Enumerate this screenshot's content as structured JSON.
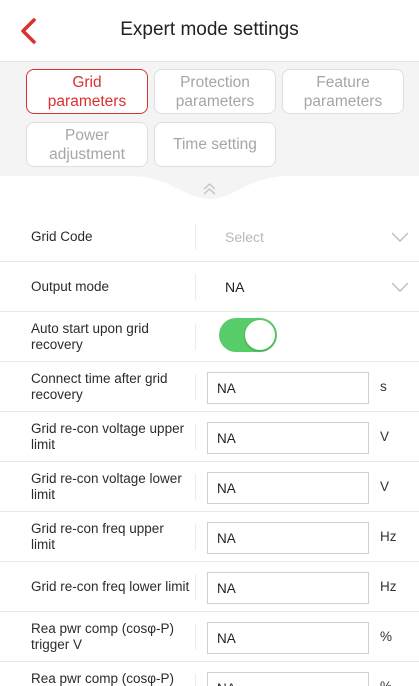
{
  "header": {
    "title": "Expert mode settings"
  },
  "tabs": [
    {
      "id": "grid",
      "label": "Grid\nparameters",
      "active": true
    },
    {
      "id": "protection",
      "label": "Protection\nparameters",
      "active": false
    },
    {
      "id": "feature",
      "label": "Feature\nparameters",
      "active": false
    },
    {
      "id": "power",
      "label": "Power\nadjustment",
      "active": false
    },
    {
      "id": "time",
      "label": "Time setting",
      "active": false
    }
  ],
  "rows": [
    {
      "label": "Grid Code",
      "type": "select",
      "value": "Select",
      "placeholder": true
    },
    {
      "label": "Output mode",
      "type": "select",
      "value": "NA",
      "placeholder": false
    },
    {
      "label": "Auto start upon grid recovery",
      "type": "toggle",
      "on": true
    },
    {
      "label": "Connect time after grid recovery",
      "type": "input",
      "value": "NA",
      "unit": "s"
    },
    {
      "label": "Grid re-con voltage upper limit",
      "type": "input",
      "value": "NA",
      "unit": "V"
    },
    {
      "label": "Grid re-con voltage lower limit",
      "type": "input",
      "value": "NA",
      "unit": "V"
    },
    {
      "label": "Grid re-con freq upper limit",
      "type": "input",
      "value": "NA",
      "unit": "Hz"
    },
    {
      "label": "Grid re-con freq lower limit",
      "type": "input",
      "value": "NA",
      "unit": "Hz"
    },
    {
      "label": "Rea pwr comp (cosφ-P) trigger V",
      "type": "input",
      "value": "NA",
      "unit": "%"
    },
    {
      "label": "Rea pwr comp (cosφ-P) exit V",
      "type": "input",
      "value": "NA",
      "unit": "%"
    }
  ],
  "colors": {
    "accent": "#d9312f",
    "toggle_on": "#57cc68",
    "panel_bg": "#f4f4f4"
  },
  "icons": {
    "back": "chevron-left-icon",
    "collapse": "double-chevron-up-icon",
    "dropdown": "chevron-down-icon"
  }
}
